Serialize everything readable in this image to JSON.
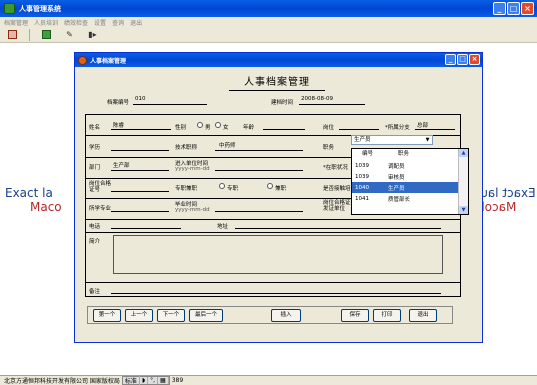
{
  "app": {
    "title": "人事管理系统",
    "menu": [
      "档案管理",
      "人员培训",
      "绩效检查",
      "设置",
      "查询",
      "退出"
    ],
    "toolbar_icons": [
      "save-icon",
      "grid-icon",
      "pen-icon",
      "exit-door-icon"
    ],
    "window_buttons": [
      "_",
      "□",
      "×"
    ]
  },
  "background": {
    "left_top": "Exact la",
    "left_bottom": "Maco",
    "right_top": "Exact launc",
    "right_bottom": "Macola"
  },
  "status": {
    "text": "北京方通恒邦科技开发有限公司  国家版权局",
    "ime": [
      "标准",
      "◗",
      "°,",
      "▦"
    ],
    "number": "389"
  },
  "dialog": {
    "title": "人事档案管理",
    "heading": "人事档案管理",
    "archive_label": "档案编号",
    "archive_value": "010",
    "date_label": "建档时间",
    "date_value": "2008-08-09",
    "fields": {
      "name_label": "姓名",
      "name_value": "陈睿",
      "gender_label": "性别",
      "male": "男",
      "female": "女",
      "age_label": "年龄",
      "post_label": "岗位",
      "branch_label": "*所属分支",
      "branch_value": "总部",
      "edu_label": "学历",
      "title_label": "技术职称",
      "title_value": "中药师",
      "duty_label": "职务",
      "duty_value": "生产员",
      "dept_label": "部门",
      "dept_value": "生产部",
      "join_label": "进入单位时间",
      "join_placeholder": "yyyy-mm-dd",
      "status_label": "*在职状况",
      "cert_label": "岗位合格证号",
      "full_label": "专职兼职",
      "full_opt1": "专职",
      "full_opt2": "兼职",
      "train_label": "是否接触培",
      "major_label": "所学专业",
      "grad_label": "毕业时间",
      "grad_placeholder": "yyyy-mm-dd",
      "cert_unit_label": "岗位合格证发证单位",
      "phone_label": "电话",
      "addr_label": "地址",
      "intro_label": "简介",
      "remark_label": "备注"
    },
    "dropdown": {
      "headers": [
        "编号",
        "职务"
      ],
      "rows": [
        {
          "id": "1039",
          "name": "调配员"
        },
        {
          "id": "1039",
          "name": "审核员"
        },
        {
          "id": "1040",
          "name": "生产员"
        },
        {
          "id": "1041",
          "name": "质管部长"
        }
      ],
      "selected_index": 2
    },
    "buttons": {
      "first": "第一个",
      "prev": "上一个",
      "next": "下一个",
      "last": "最后一个",
      "insert": "插入",
      "save": "保存",
      "print": "打印",
      "exit": "退出"
    }
  }
}
